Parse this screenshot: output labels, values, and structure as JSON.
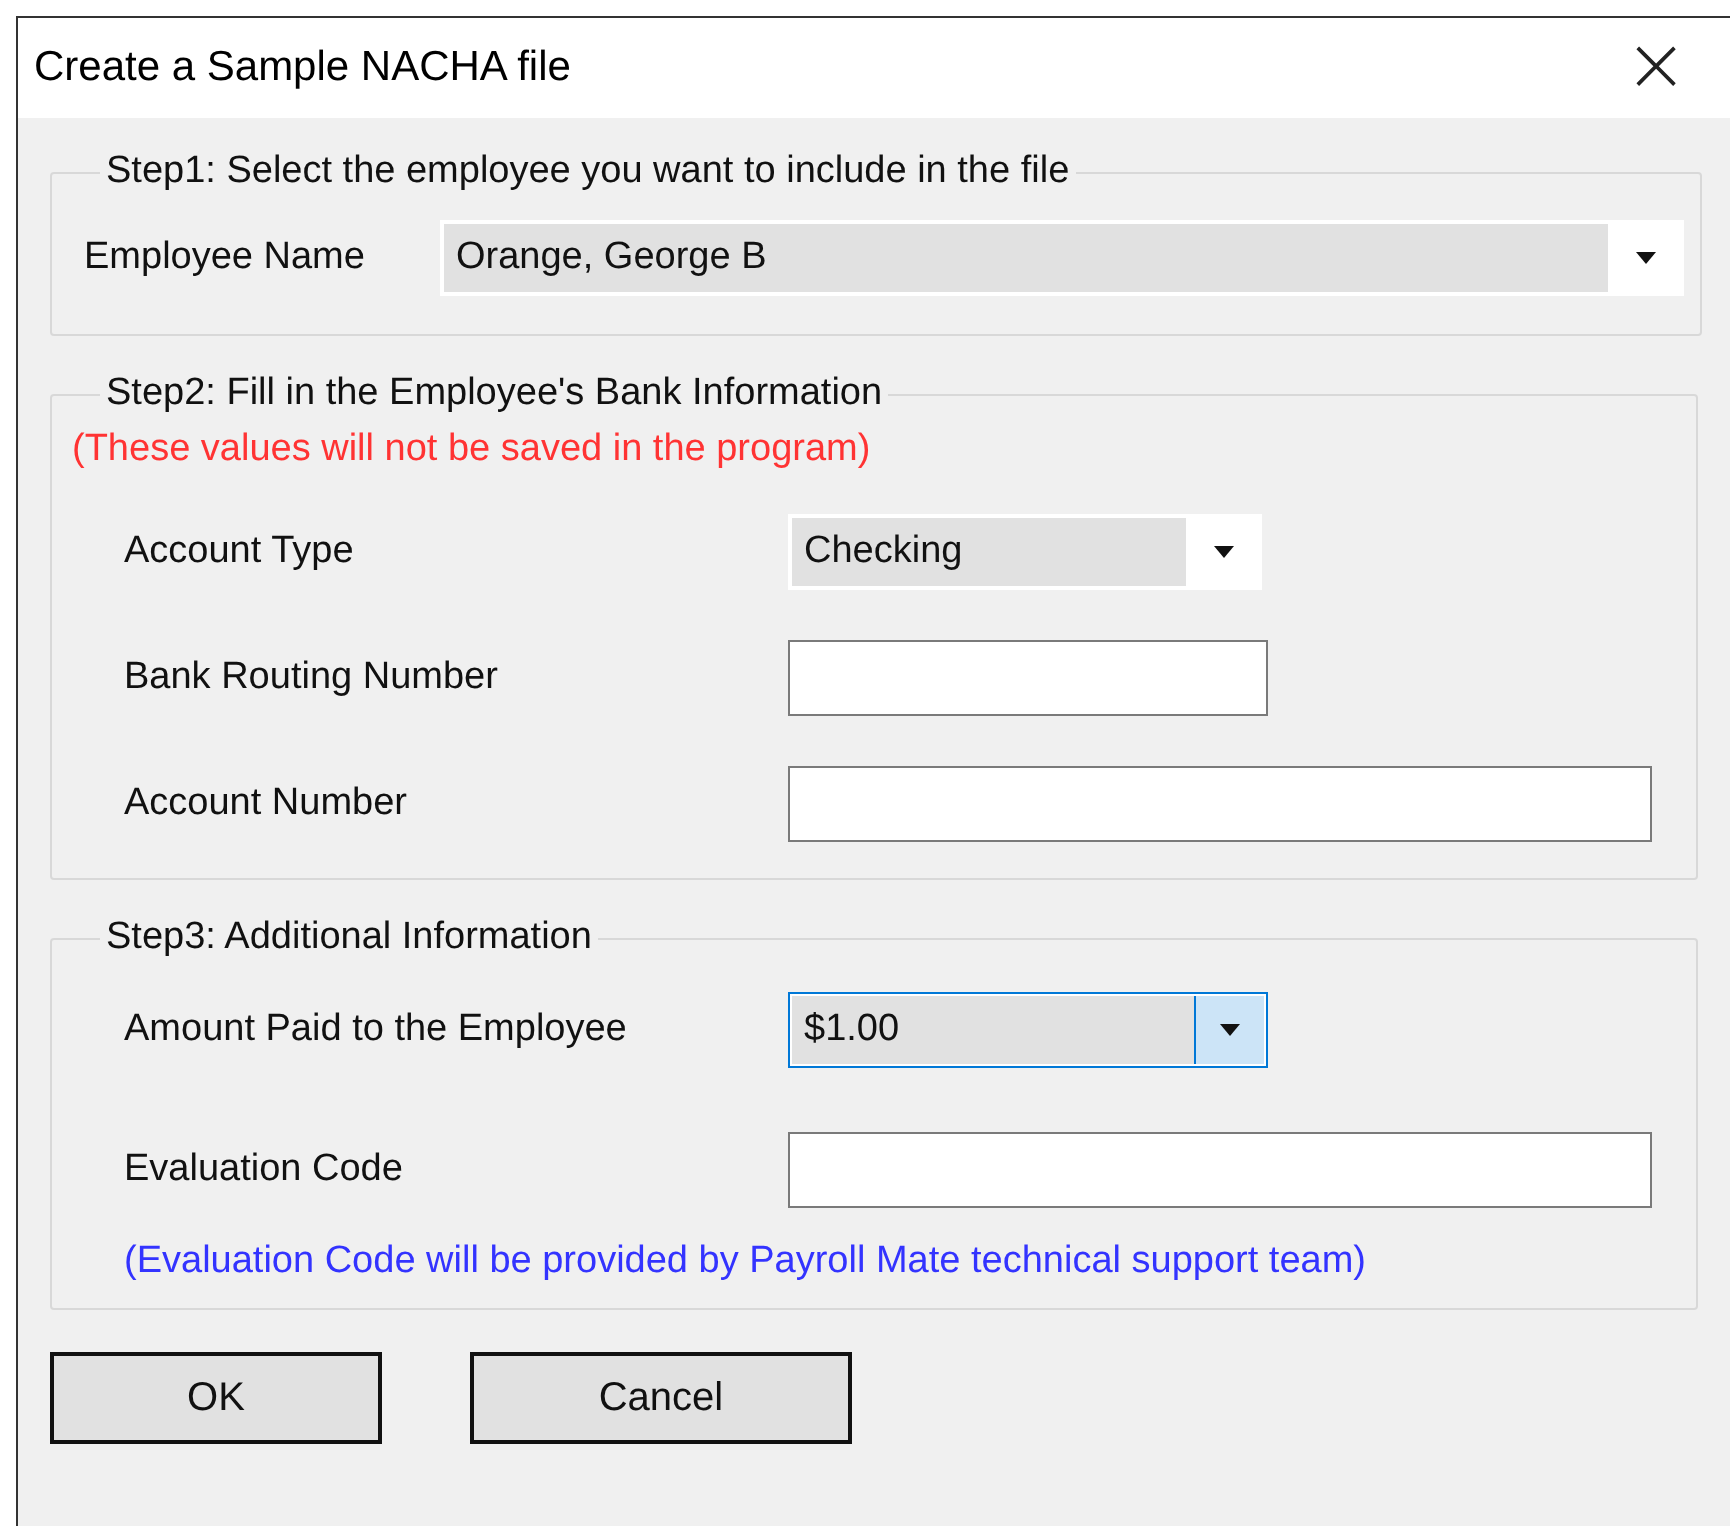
{
  "window": {
    "title": "Create a Sample NACHA file",
    "close": "×"
  },
  "sections": [
    {
      "legend": "Step1: Select the employee you want to include in the file",
      "fields": [
        {
          "label": "Employee Name",
          "kind": "combo",
          "value": "Orange, George B",
          "focused": false
        }
      ]
    },
    {
      "legend": "Step2: Fill in the Employee's Bank Information",
      "note_above": {
        "text": "(These values will not be saved in the program)",
        "color": "#ff3333"
      },
      "fields": [
        {
          "label": "Account Type",
          "kind": "combo",
          "value": "Checking",
          "focused": false
        },
        {
          "label": "Bank Routing Number",
          "kind": "text",
          "focused": false
        },
        {
          "label": "Account Number",
          "kind": "text",
          "focused": false
        }
      ]
    },
    {
      "legend": "Step3: Additional Information",
      "note_below": {
        "text": "(Evaluation Code will be provided by Payroll Mate technical support team)",
        "color": "#3333ff"
      },
      "fields": [
        {
          "label": "Amount Paid to the Employee",
          "kind": "combo",
          "value": "$1.00",
          "focused": true
        },
        {
          "label": "Evaluation Code",
          "kind": "text",
          "focused": false
        }
      ]
    }
  ],
  "buttons": [
    "OK",
    "Cancel"
  ]
}
